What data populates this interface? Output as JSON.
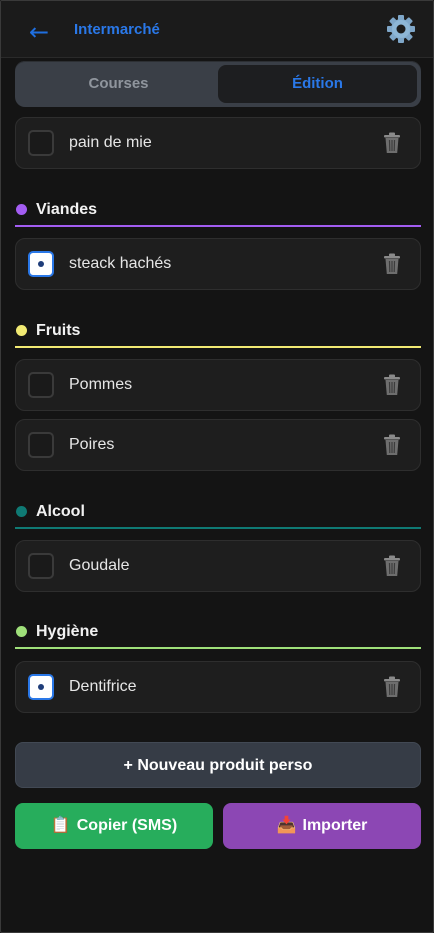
{
  "header": {
    "back_icon": "←",
    "title": "Intermarché",
    "settings_icon": "gear-icon"
  },
  "segmented": {
    "tab_courses": "Courses",
    "tab_edition": "Édition",
    "active": "Édition"
  },
  "partial_item": {
    "label": "pain de mie",
    "checked": false
  },
  "categories": [
    {
      "name": "Viandes",
      "color": "#a35df2",
      "items": [
        {
          "label": "steack hachés",
          "checked": true
        }
      ]
    },
    {
      "name": "Fruits",
      "color": "#f1ea73",
      "items": [
        {
          "label": "Pommes",
          "checked": false
        },
        {
          "label": "Poires",
          "checked": false
        }
      ]
    },
    {
      "name": "Alcool",
      "color": "#0f7a74",
      "items": [
        {
          "label": "Goudale",
          "checked": false
        }
      ]
    },
    {
      "name": "Hygiène",
      "color": "#9fe07a",
      "items": [
        {
          "label": "Dentifrice",
          "checked": true
        }
      ]
    }
  ],
  "buttons": {
    "new_product": "+ Nouveau produit perso",
    "copy_icon": "📋",
    "copy": "Copier (SMS)",
    "import_icon": "📥",
    "import": "Importer"
  }
}
